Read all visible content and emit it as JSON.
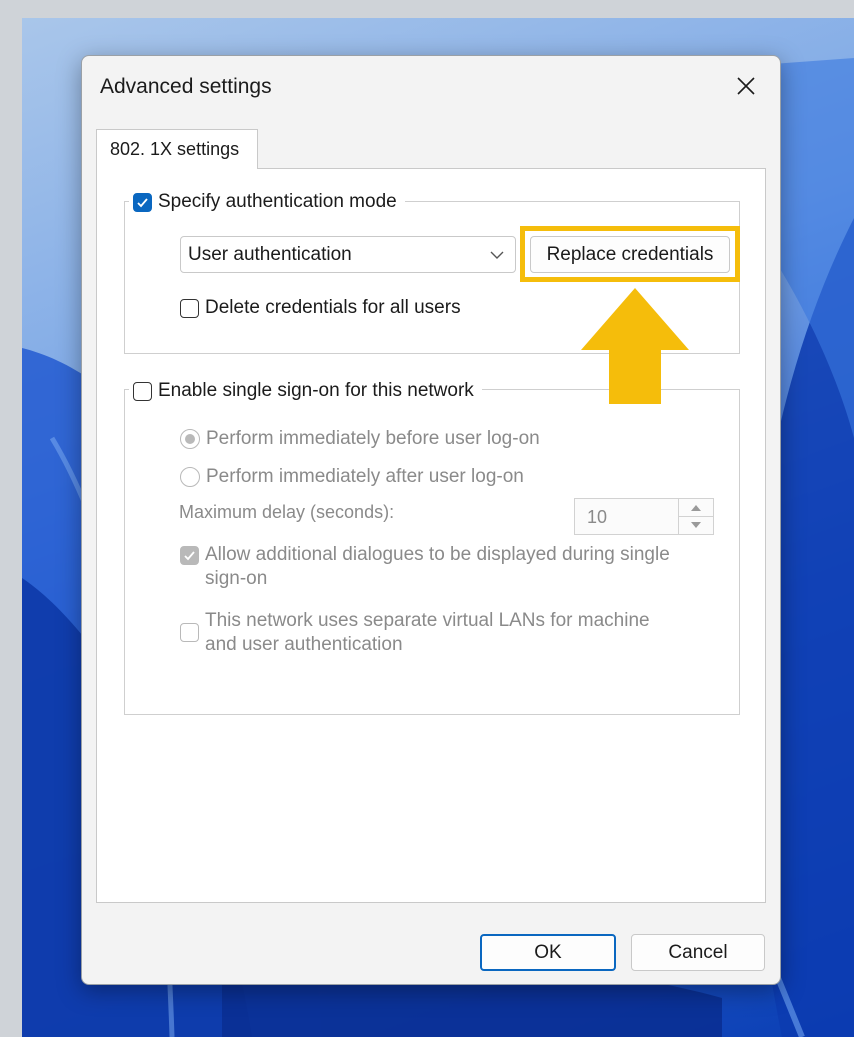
{
  "dialog": {
    "title": "Advanced settings",
    "tab_label": "802. 1X settings"
  },
  "auth_mode": {
    "label": "Specify authentication mode",
    "checked": true,
    "select_value": "User authentication",
    "replace_button": "Replace credentials",
    "delete_label": "Delete credentials for all users",
    "delete_checked": false
  },
  "sso": {
    "label": "Enable single sign-on for this network",
    "checked": false,
    "radio_before": "Perform immediately before user log-on",
    "radio_after": "Perform immediately after user log-on",
    "selected_radio": "before",
    "max_delay_label": "Maximum delay (seconds):",
    "max_delay_value": "10",
    "allow_dialogs_line1": "Allow additional dialogues to be displayed during single",
    "allow_dialogs_line2": "sign-on",
    "allow_dialogs_checked": true,
    "vlan_line1": "This network uses separate virtual LANs for machine",
    "vlan_line2": "and user authentication",
    "vlan_checked": false
  },
  "footer": {
    "ok_label": "OK",
    "cancel_label": "Cancel"
  },
  "colors": {
    "highlight": "#f5bd0b",
    "accent": "#0a67c0"
  },
  "icons": [
    "close-icon",
    "checkmark-icon",
    "chevron-down-icon",
    "arrow-up-icon",
    "spin-up-icon",
    "spin-down-icon"
  ]
}
